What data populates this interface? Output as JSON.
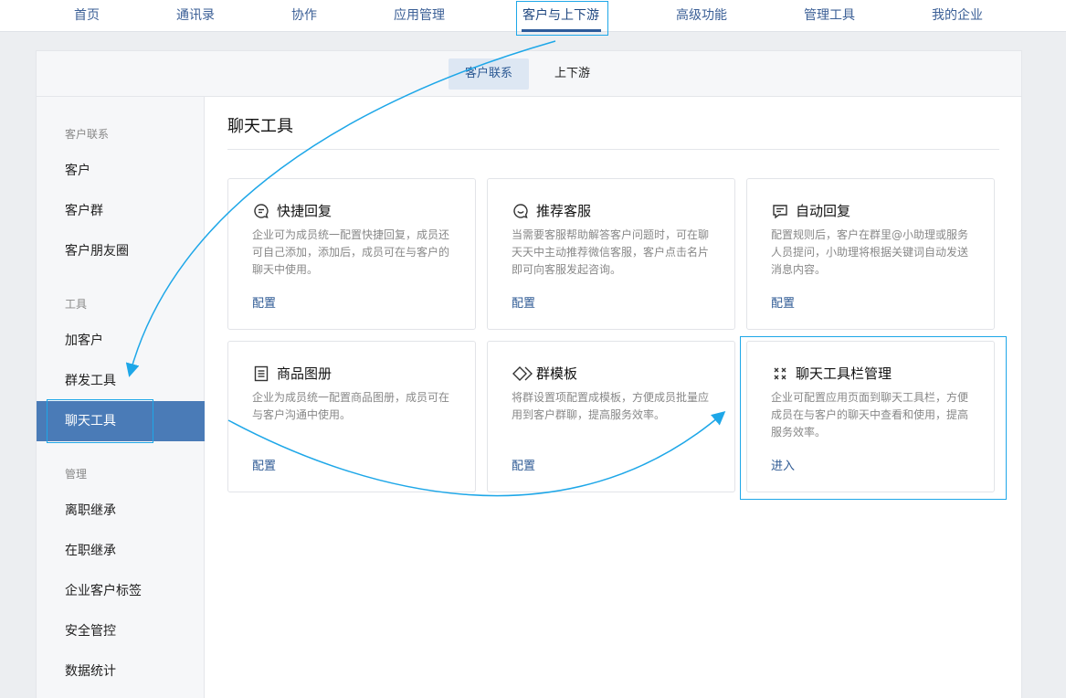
{
  "topnav": {
    "items": [
      {
        "label": "首页"
      },
      {
        "label": "通讯录"
      },
      {
        "label": "协作"
      },
      {
        "label": "应用管理"
      },
      {
        "label": "客户与上下游"
      },
      {
        "label": "高级功能"
      },
      {
        "label": "管理工具"
      },
      {
        "label": "我的企业"
      }
    ],
    "active_index": 4
  },
  "subtabs": [
    {
      "label": "客户联系"
    },
    {
      "label": "上下游"
    }
  ],
  "sidebar": {
    "groups": [
      {
        "title": "客户联系",
        "items": [
          "客户",
          "客户群",
          "客户朋友圈"
        ]
      },
      {
        "title": "工具",
        "items": [
          "加客户",
          "群发工具",
          "聊天工具"
        ]
      },
      {
        "title": "管理",
        "items": [
          "离职继承",
          "在职继承",
          "企业客户标签",
          "安全管控",
          "数据统计"
        ]
      }
    ],
    "active_item": "聊天工具"
  },
  "main": {
    "title": "聊天工具",
    "cards": [
      {
        "icon": "chat-bubble-icon",
        "title": "快捷回复",
        "desc": "企业可为成员统一配置快捷回复，成员还可自己添加，添加后，成员可在与客户的聊天中使用。",
        "link": "配置"
      },
      {
        "icon": "smile-bubble-icon",
        "title": "推荐客服",
        "desc": "当需要客服帮助解答客户问题时，可在聊天天中主动推荐微信客服，客户点击名片即可向客服发起咨询。",
        "link": "配置"
      },
      {
        "icon": "message-lines-icon",
        "title": "自动回复",
        "desc": "配置规则后，客户在群里@小助理或服务人员提问，小助理将根据关键词自动发送消息内容。",
        "link": "配置"
      },
      {
        "icon": "catalog-icon",
        "title": "商品图册",
        "desc": "企业为成员统一配置商品图册，成员可在与客户沟通中使用。",
        "link": "配置"
      },
      {
        "icon": "diamond-template-icon",
        "title": "群模板",
        "desc": "将群设置项配置成模板，方便成员批量应用到客户群聊，提高服务效率。",
        "link": "配置"
      },
      {
        "icon": "toolbar-grid-icon",
        "title": "聊天工具栏管理",
        "desc": "企业可配置应用页面到聊天工具栏，方便成员在与客户的聊天中查看和使用，提高服务效率。",
        "link": "进入"
      }
    ]
  },
  "colors": {
    "accent": "#2e5a94",
    "sidebar_active": "#4a7bb7",
    "annotation": "#1ea7e8"
  }
}
